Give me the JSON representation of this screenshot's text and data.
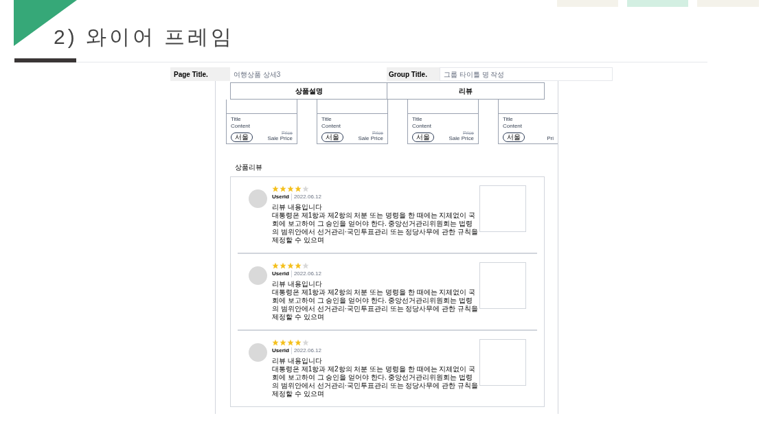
{
  "slide": {
    "title": "2) 와이어 프레임"
  },
  "header": {
    "page_title_label": "Page Title.",
    "page_title_value": "여행상품 상세3",
    "group_title_label": "Group Title.",
    "group_title_placeholder": "그룹 타이틀 명 작성"
  },
  "tabs": [
    {
      "label": "상품설명"
    },
    {
      "label": "리뷰"
    }
  ],
  "products": [
    {
      "title": "Title",
      "content": "Content",
      "badge": "서울",
      "price": "Price",
      "sale_price": "Sale Price"
    },
    {
      "title": "Title",
      "content": "Content",
      "badge": "서울",
      "price": "Price",
      "sale_price": "Sale Price"
    },
    {
      "title": "Title",
      "content": "Content",
      "badge": "서울",
      "price": "Price",
      "sale_price": "Sale Price"
    },
    {
      "title": "Title",
      "content": "Content",
      "badge": "서울",
      "sale_price": "Pri"
    }
  ],
  "reviews_heading": "상품리뷰",
  "reviews": [
    {
      "stars": 4,
      "user": "Userid",
      "date": "2022.06.12",
      "title": "리뷰 내용입니다",
      "body": "대통령은 제1항과 제2항의 처분 또는 명령을 한 때에는 지체없이 국회에 보고하여 그 승인을 얻어야 한다. 중앙선거관리위원회는 법령의 범위안에서 선거관리·국민투표관리 또는 정당사무에 관한 규칙을 제정할 수 있으며"
    },
    {
      "stars": 4,
      "user": "Userid",
      "date": "2022.06.12",
      "title": "리뷰 내용입니다",
      "body": "대통령은 제1항과 제2항의 처분 또는 명령을 한 때에는 지체없이 국회에 보고하여 그 승인을 얻어야 한다. 중앙선거관리위원회는 법령의 범위안에서 선거관리·국민투표관리 또는 정당사무에 관한 규칙을 제정할 수 있으며"
    },
    {
      "stars": 4,
      "user": "Userid",
      "date": "2022.06.12",
      "title": "리뷰 내용입니다",
      "body": "대통령은 제1항과 제2항의 처분 또는 명령을 한 때에는 지체없이 국회에 보고하여 그 승인을 얻어야 한다. 중앙선거관리위원회는 법령의 범위안에서 선거관리·국민투표관리 또는 정당사무에 관한 규칙을 제정할 수 있으며"
    }
  ]
}
